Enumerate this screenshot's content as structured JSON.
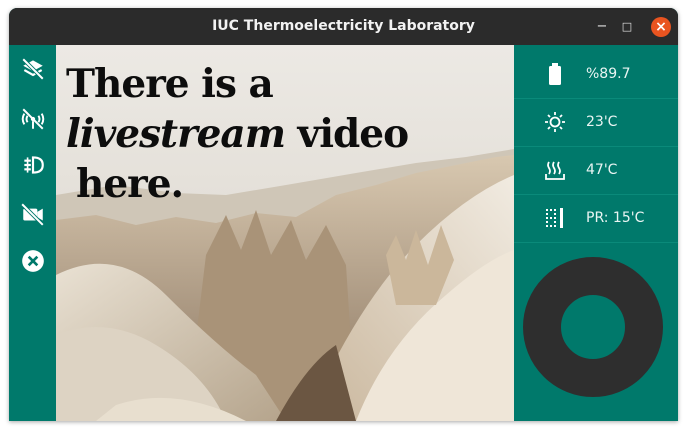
{
  "window": {
    "title": "IUC Thermoelectricity Laboratory"
  },
  "titlebar_buttons": {
    "minimize": "−",
    "maximize": "□",
    "close": "×"
  },
  "sidebar": {
    "items": [
      {
        "icon": "layers-off-icon"
      },
      {
        "icon": "signal-off-icon"
      },
      {
        "icon": "fog-light-icon"
      },
      {
        "icon": "camera-off-icon"
      },
      {
        "icon": "close-circle-icon"
      }
    ]
  },
  "video": {
    "line1": "There is a",
    "line2_italic": "livestream",
    "line2_rest": " video",
    "line3": "here."
  },
  "readings": {
    "battery": {
      "icon": "battery-icon",
      "value": "%89.7"
    },
    "ambient": {
      "icon": "sun-icon",
      "value": "23'C"
    },
    "heater": {
      "icon": "heat-icon",
      "value": "47'C"
    },
    "pr": {
      "icon": "dotted-grid-icon",
      "value": "PR: 15'C"
    }
  },
  "colors": {
    "accent": "#00796b",
    "titlebar": "#2b2b2b",
    "close": "#e95420",
    "gauge": "#2e2e2e"
  }
}
